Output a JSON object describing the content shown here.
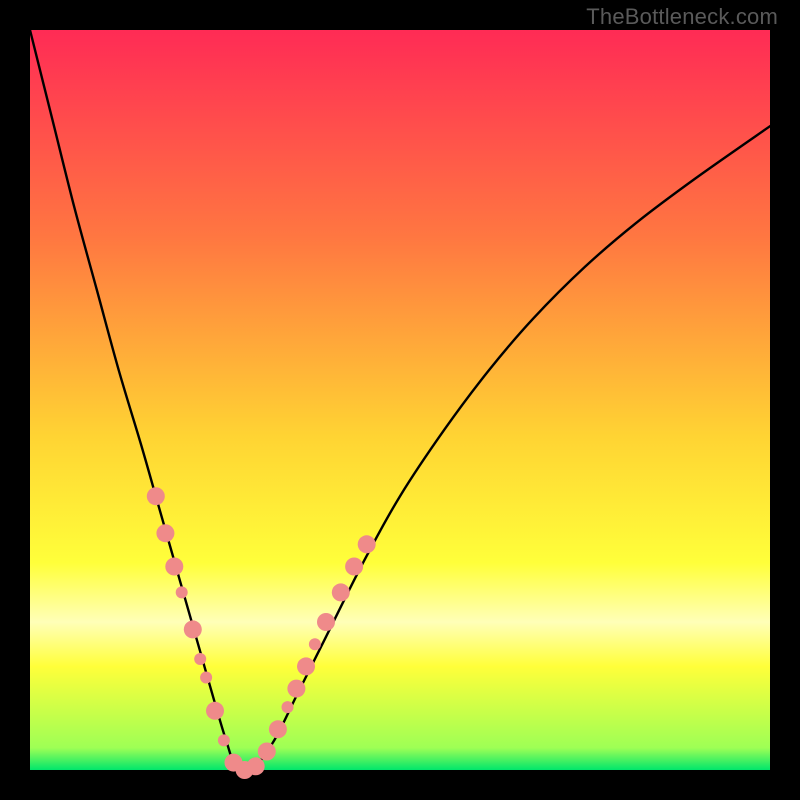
{
  "watermark": "TheBottleneck.com",
  "chart_data": {
    "type": "line",
    "title": "",
    "xlabel": "",
    "ylabel": "",
    "xlim": [
      0,
      100
    ],
    "ylim": [
      0,
      100
    ],
    "gradient": {
      "stops": [
        {
          "offset": 0,
          "color": "#ff2b55"
        },
        {
          "offset": 28,
          "color": "#ff7741"
        },
        {
          "offset": 55,
          "color": "#ffd433"
        },
        {
          "offset": 72,
          "color": "#ffff3a"
        },
        {
          "offset": 80,
          "color": "#ffffb8"
        },
        {
          "offset": 86,
          "color": "#ffff3a"
        },
        {
          "offset": 97,
          "color": "#9eff55"
        },
        {
          "offset": 100,
          "color": "#00e66b"
        }
      ]
    },
    "series": [
      {
        "name": "bottleneck-curve",
        "x": [
          0,
          3,
          6,
          9,
          12,
          15,
          17,
          19,
          21,
          23,
          25,
          26.5,
          28,
          30,
          33,
          36,
          40,
          45,
          50,
          56,
          62,
          68,
          75,
          82,
          90,
          100
        ],
        "y": [
          100,
          88,
          76,
          65,
          54,
          44,
          37,
          30,
          23,
          16,
          9,
          4,
          0,
          0,
          4,
          10,
          18,
          28,
          37,
          46,
          54,
          61,
          68,
          74,
          80,
          87
        ]
      }
    ],
    "markers": {
      "color": "#ef8a8a",
      "radius_primary": 9,
      "radius_secondary": 6,
      "points": [
        {
          "x": 17.0,
          "y": 37.0,
          "r": "primary"
        },
        {
          "x": 18.3,
          "y": 32.0,
          "r": "primary"
        },
        {
          "x": 19.5,
          "y": 27.5,
          "r": "primary"
        },
        {
          "x": 20.5,
          "y": 24.0,
          "r": "secondary"
        },
        {
          "x": 22.0,
          "y": 19.0,
          "r": "primary"
        },
        {
          "x": 23.0,
          "y": 15.0,
          "r": "secondary"
        },
        {
          "x": 23.8,
          "y": 12.5,
          "r": "secondary"
        },
        {
          "x": 25.0,
          "y": 8.0,
          "r": "primary"
        },
        {
          "x": 26.2,
          "y": 4.0,
          "r": "secondary"
        },
        {
          "x": 27.5,
          "y": 1.0,
          "r": "primary"
        },
        {
          "x": 29.0,
          "y": 0.0,
          "r": "primary"
        },
        {
          "x": 30.5,
          "y": 0.5,
          "r": "primary"
        },
        {
          "x": 32.0,
          "y": 2.5,
          "r": "primary"
        },
        {
          "x": 33.5,
          "y": 5.5,
          "r": "primary"
        },
        {
          "x": 34.8,
          "y": 8.5,
          "r": "secondary"
        },
        {
          "x": 36.0,
          "y": 11.0,
          "r": "primary"
        },
        {
          "x": 37.3,
          "y": 14.0,
          "r": "primary"
        },
        {
          "x": 38.5,
          "y": 17.0,
          "r": "secondary"
        },
        {
          "x": 40.0,
          "y": 20.0,
          "r": "primary"
        },
        {
          "x": 42.0,
          "y": 24.0,
          "r": "primary"
        },
        {
          "x": 43.8,
          "y": 27.5,
          "r": "primary"
        },
        {
          "x": 45.5,
          "y": 30.5,
          "r": "primary"
        }
      ]
    }
  }
}
